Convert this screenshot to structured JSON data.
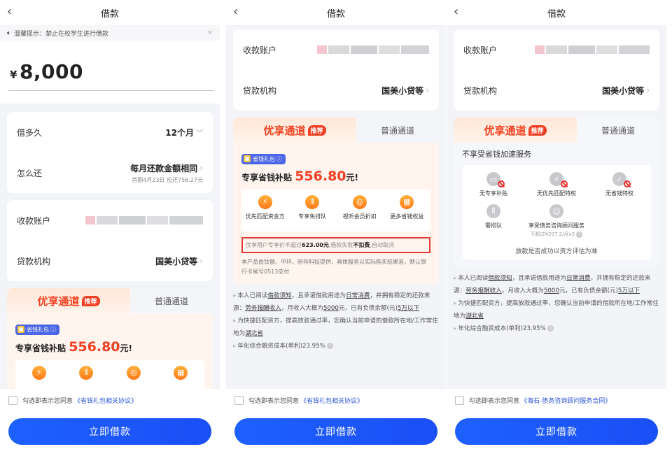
{
  "screens": [
    {
      "title": "借款",
      "notice": "温馨提示：禁止在校学生进行借款",
      "amount_currency": "¥",
      "amount_value": "8,000",
      "term_label": "借多久",
      "term_value": "12个月",
      "repay_label": "怎么还",
      "repay_value": "每月还款金额相同",
      "repay_note": "首期4月23日 应还756.27元",
      "account_label": "收款账户",
      "lender_label": "贷款机构",
      "lender_value": "国美小贷等",
      "tab_vip": "优享通道",
      "tab_vip_tag": "推荐",
      "tab_normal": "普通通道",
      "gift_label": "省钱礼包",
      "subsidy_prefix": "专享省钱补贴",
      "subsidy_amount": "556.80",
      "subsidy_suffix": "元!",
      "agree_prefix": "勾选即表示您同意",
      "agree_link": "《省钱礼包相关协议》",
      "submit": "立即借款"
    },
    {
      "title": "借款",
      "account_label": "收款账户",
      "lender_label": "贷款机构",
      "lender_value": "国美小贷等",
      "tab_vip": "优享通道",
      "tab_vip_tag": "推荐",
      "tab_normal": "普通通道",
      "gift_label": "省钱礼包",
      "subsidy_prefix": "专享省钱补贴",
      "subsidy_amount": "556.80",
      "subsidy_suffix": "元!",
      "benefits": [
        "优先匹配资金方",
        "专享免排队",
        "视听会员折扣",
        "更多省钱权益"
      ],
      "hl_prefix": "优享用户专享价不超过",
      "hl_price": "623.00元",
      "hl_mid": ",借款失败",
      "hl_nofee": "不扣费",
      "hl_suffix": ",自动取消",
      "fine": "本产品由钛额、中环、陪伴科技提供，具体服务以实际购买结果准，默认银行卡尾号0513支付",
      "agree_prefix": "勾选即表示您同意",
      "agree_link": "《省钱礼包相关协议》",
      "submit": "立即借款"
    },
    {
      "title": "借款",
      "account_label": "收款账户",
      "lender_label": "贷款机构",
      "lender_value": "国美小贷等",
      "tab_vip": "优享通道",
      "tab_vip_tag": "推荐",
      "tab_normal": "普通通道",
      "no_service_title": "不享受省钱加速服务",
      "no_items": [
        "无专享补贴",
        "无优先匹配特权",
        "无省钱特权",
        "需排队",
        "享受债务咨询顾问服务"
      ],
      "no_item_note": "不超过¥207.2/月x3",
      "result_note": "放款是否成功以资方评估为准",
      "agree_prefix": "勾选即表示您同意",
      "agree_link": "《海石-债务咨询顾问服务合同》",
      "submit": "立即借款"
    }
  ],
  "terms": {
    "t1a": "本人已阅读",
    "t1b": "借款须知",
    "t1c": "，且承诺借款用途为",
    "t1d": "日常消费",
    "t1e": "，并拥有稳定的还款来源：",
    "t1f": "劳务报酬收入",
    "t1g": "，月收入大概为",
    "t1h": "5000",
    "t1i": "元，已有负债余额(元)",
    "t1j": "5万以下",
    "t2a": "为快捷匹配资方，提高放款通过率，您确认当前申请的借款所在地/工作常住地为",
    "t2b": "湖北省",
    "t3": "年化综合融资成本(单利)23.95%"
  },
  "colors": {
    "accent": "#1e60ff",
    "vip": "#ef3f24",
    "highlight_border": "#e53935"
  }
}
